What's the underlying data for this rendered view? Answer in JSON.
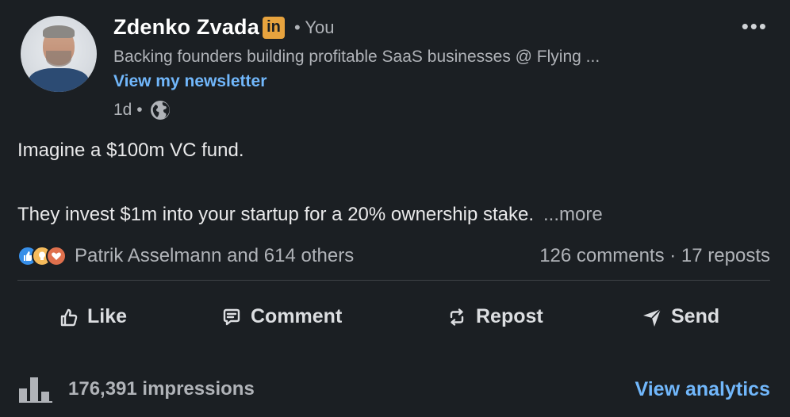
{
  "author": {
    "name": "Zdenko Zvada",
    "badge": "in",
    "relation": "• You",
    "headline": "Backing founders building profitable SaaS businesses @ Flying ...",
    "newsletter_link": "View my newsletter",
    "time": "1d •",
    "visibility_icon": "globe-icon"
  },
  "menu_icon": "•••",
  "post": {
    "line1": "Imagine a $100m VC fund.",
    "line2": "They invest $1m into your startup for a 20% ownership stake.",
    "see_more": "...more"
  },
  "social": {
    "reaction_icons": [
      "like-icon",
      "insightful-icon",
      "love-icon"
    ],
    "reactions_text": "Patrik Asselmann and 614 others",
    "counts_text": "126 comments · 17 reposts"
  },
  "actions": {
    "like": "Like",
    "comment": "Comment",
    "repost": "Repost",
    "send": "Send"
  },
  "footer": {
    "impressions": "176,391 impressions",
    "analytics_link": "View analytics"
  },
  "colors": {
    "background": "#1b1f23",
    "link": "#71b7fb",
    "badge": "#e7a33e",
    "muted": "#b0b3b8"
  }
}
